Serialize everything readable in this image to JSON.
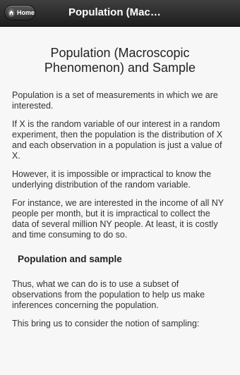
{
  "header": {
    "home_label": "Home",
    "title": "Population (Mac…"
  },
  "page": {
    "heading": "Population (Macroscopic Phenomenon) and Sample",
    "paragraphs": [
      "Population is a set of measurements in which we are interested.",
      "If X is the random variable of our interest in a random experiment, then the population is the distribution of X and each observation in a population is just a value of X.",
      "However, it is impossible or impractical to know the underlying distribution of the random variable.",
      "For instance, we are interested in the income of all NY people per month, but it is impractical to collect the data of several million NY people. At least, it is costly and time consuming to do so."
    ],
    "subheading": "Population and sample",
    "paragraphs2": [
      "Thus, what we can do is to use a subset of observations from the population to help us make inferences concerning the population.",
      "This bring us to consider the notion of sampling:"
    ]
  }
}
